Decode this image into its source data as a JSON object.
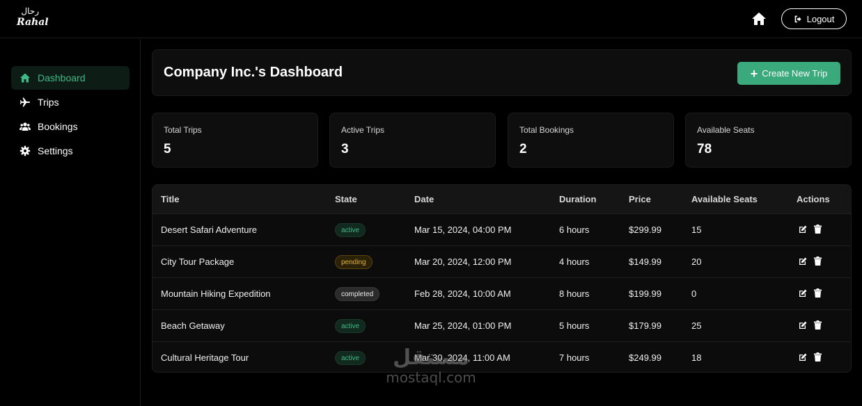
{
  "header": {
    "logo_arabic": "رحال",
    "logo_text": "Rahal",
    "logout_label": "Logout"
  },
  "sidebar": {
    "items": [
      {
        "label": "Dashboard",
        "icon": "home-icon",
        "active": true
      },
      {
        "label": "Trips",
        "icon": "plane-icon",
        "active": false
      },
      {
        "label": "Bookings",
        "icon": "users-icon",
        "active": false
      },
      {
        "label": "Settings",
        "icon": "gear-icon",
        "active": false
      }
    ]
  },
  "main": {
    "title": "Company Inc.'s Dashboard",
    "create_label": "Create New Trip",
    "stats": [
      {
        "label": "Total Trips",
        "value": "5"
      },
      {
        "label": "Active Trips",
        "value": "3"
      },
      {
        "label": "Total Bookings",
        "value": "2"
      },
      {
        "label": "Available Seats",
        "value": "78"
      }
    ]
  },
  "table": {
    "columns": [
      "Title",
      "State",
      "Date",
      "Duration",
      "Price",
      "Available Seats",
      "Actions"
    ],
    "rows": [
      {
        "title": "Desert Safari Adventure",
        "state": "active",
        "date": "Mar 15, 2024, 04:00 PM",
        "duration": "6 hours",
        "price": "$299.99",
        "seats": "15"
      },
      {
        "title": "City Tour Package",
        "state": "pending",
        "date": "Mar 20, 2024, 12:00 PM",
        "duration": "4 hours",
        "price": "$149.99",
        "seats": "20"
      },
      {
        "title": "Mountain Hiking Expedition",
        "state": "completed",
        "date": "Feb 28, 2024, 10:00 AM",
        "duration": "8 hours",
        "price": "$199.99",
        "seats": "0"
      },
      {
        "title": "Beach Getaway",
        "state": "active",
        "date": "Mar 25, 2024, 01:00 PM",
        "duration": "5 hours",
        "price": "$179.99",
        "seats": "25"
      },
      {
        "title": "Cultural Heritage Tour",
        "state": "active",
        "date": "Mar 30, 2024, 11:00 AM",
        "duration": "7 hours",
        "price": "$249.99",
        "seats": "18"
      }
    ]
  },
  "watermark": {
    "arabic": "مستقل",
    "latin": "mostaql.com"
  },
  "colors": {
    "accent": "#3aaa7d",
    "background": "#000000",
    "card": "#0e0e0e"
  }
}
